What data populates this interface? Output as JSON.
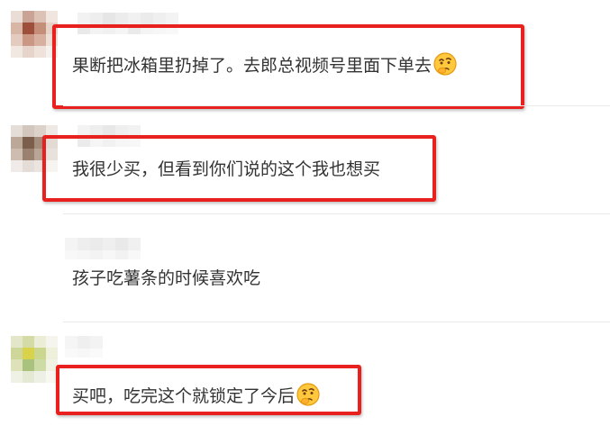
{
  "comments": [
    {
      "id": "c1",
      "text": "果断把冰箱里扔掉了。去郎总视频号里面下单去",
      "emoji": "thinking-face",
      "highlighted": true
    },
    {
      "id": "c2",
      "text": "我很少买，但看到你们说的这个我也想买",
      "emoji": "",
      "highlighted": true
    },
    {
      "id": "c3",
      "text": "孩子吃薯条的时候喜欢吃",
      "emoji": "",
      "highlighted": false
    },
    {
      "id": "c4",
      "text": "买吧，吃完这个就锁定了今后",
      "emoji": "thinking-face",
      "highlighted": true
    }
  ],
  "colors": {
    "highlight": "#e8201e",
    "text": "#333333",
    "divider": "#e9e9e9"
  }
}
